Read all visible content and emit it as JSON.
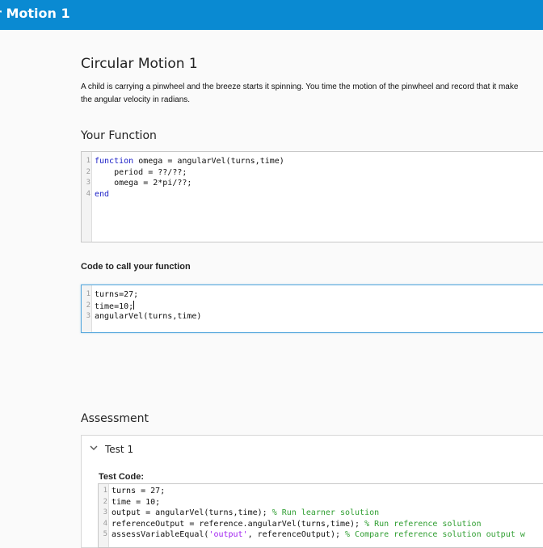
{
  "header": {
    "title": "r Motion 1"
  },
  "problem": {
    "title": "Circular Motion 1",
    "description_line1": "A child is carrying a pinwheel and the breeze starts it spinning.  You time the motion of the pinwheel and record that it make",
    "description_line2": "the angular velocity in radians."
  },
  "your_function": {
    "label": "Your Function",
    "line_numbers": [
      "1",
      "2",
      "3",
      "4"
    ],
    "lines": [
      {
        "kw": "function",
        "rest": " omega = angularVel(turns,time)"
      },
      {
        "kw": "",
        "rest": "    period = ??/??;"
      },
      {
        "kw": "",
        "rest": "    omega = 2*pi/??;"
      },
      {
        "kw": "end",
        "rest": ""
      }
    ]
  },
  "call_code": {
    "label": "Code to call your function",
    "line_numbers": [
      "1",
      "2",
      "3"
    ],
    "lines": [
      "turns=27;",
      "time=10;",
      "angularVel(turns,time)"
    ]
  },
  "assessment": {
    "label": "Assessment",
    "test": {
      "title": "Test 1",
      "code_label": "Test Code:",
      "line_numbers": [
        "1",
        "2",
        "3",
        "4",
        "5"
      ],
      "lines": [
        {
          "code": "turns = 27;",
          "comment": ""
        },
        {
          "code": "time = 10;",
          "comment": ""
        },
        {
          "code": "output = angularVel(turns,time); ",
          "comment": "% Run learner solution"
        },
        {
          "code": "referenceOutput = reference.angularVel(turns,time); ",
          "comment": "% Run reference solution"
        },
        {
          "code": "assessVariableEqual(",
          "str": "'output'",
          "code2": ", referenceOutput); ",
          "comment": "% Compare reference solution output w"
        }
      ]
    }
  },
  "colors": {
    "header_bg": "#0a8ad2",
    "keyword": "#1d21c7",
    "comment": "#2f9e31",
    "string": "#a020f0",
    "active_border": "#57a8dd"
  },
  "icons": {
    "test_toggle": "chevron-down-icon"
  }
}
